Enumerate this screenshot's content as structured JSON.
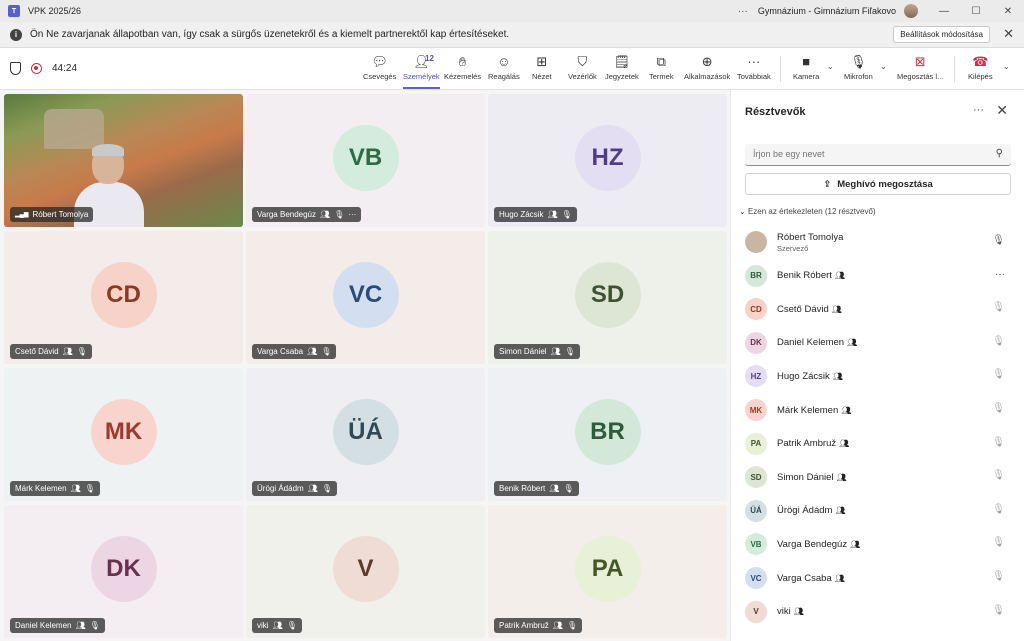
{
  "window": {
    "title": "VPK 2025/26",
    "org": "Gymnázium - Gimnázium Fiľakovo",
    "more": "···",
    "minimize": "—",
    "maximize": "☐",
    "close": "✕"
  },
  "banner": {
    "text": "Ön Ne zavarjanak állapotban van, így csak a sürgős üzenetekről és a kiemelt partnerektől kap értesítéseket.",
    "button": "Beállítások módosítása",
    "close": "✕"
  },
  "meeting": {
    "timer": "44:24"
  },
  "toolbar": {
    "chat": "Csevegés",
    "people": "Személyek",
    "people_count": "12",
    "hand": "Kézemelés",
    "react": "Reagálás",
    "view": "Nézet",
    "controls": "Vezérlők",
    "notes": "Jegyzetek",
    "rooms": "Termek",
    "apps": "Alkalmazások",
    "more": "Továbbiak",
    "camera": "Kamera",
    "mic": "Mikrofon",
    "share": "Megosztás l...",
    "leave": "Kilépés"
  },
  "tiles": [
    {
      "name": "Róbert Tomolya",
      "initials": "",
      "video": true
    },
    {
      "name": "Varga Bendegúz",
      "initials": "VB",
      "bg": "#d3ecdc",
      "fg": "#2e6b45"
    },
    {
      "name": "Hugo Zácsik",
      "initials": "HZ",
      "bg": "#e4def3",
      "fg": "#4f3e86"
    },
    {
      "name": "Csető Dávid",
      "initials": "CD",
      "bg": "#f7d2c8",
      "fg": "#8a3a23"
    },
    {
      "name": "Varga Csaba",
      "initials": "VC",
      "bg": "#d3dff0",
      "fg": "#2b4a7c"
    },
    {
      "name": "Simon Dániel",
      "initials": "SD",
      "bg": "#dde6d4",
      "fg": "#3f5230"
    },
    {
      "name": "Márk Kelemen",
      "initials": "MK",
      "bg": "#f9d4cf",
      "fg": "#9a3b2e"
    },
    {
      "name": "Ürögi Ádádm",
      "initials": "ÜÁ",
      "bg": "#d4dfe3",
      "fg": "#2f4a55"
    },
    {
      "name": "Benik Róbert",
      "initials": "BR",
      "bg": "#d4e8d9",
      "fg": "#2e5c3b"
    },
    {
      "name": "Daniel Kelemen",
      "initials": "DK",
      "bg": "#ecd6e3",
      "fg": "#6b2f52"
    },
    {
      "name": "viki",
      "initials": "V",
      "bg": "#efdcd4",
      "fg": "#5c3a2c"
    },
    {
      "name": "Patrik Ambruž",
      "initials": "PA",
      "bg": "#e8f0d8",
      "fg": "#44572a"
    }
  ],
  "panel": {
    "title": "Résztvevők",
    "search_placeholder": "Írjon be egy nevet",
    "share_label": "Meghívó megosztása",
    "section": "Ezen az értekezleten (12 résztvevő)",
    "participants": [
      {
        "name": "Róbert Tomolya",
        "role": "Szervező",
        "initials": "",
        "bg": "#c9b5a4",
        "fg": "#333"
      },
      {
        "name": "Benik Róbert",
        "initials": "BR",
        "bg": "#d4e8d9",
        "fg": "#2e5c3b"
      },
      {
        "name": "Csető Dávid",
        "initials": "CD",
        "bg": "#f7d2c8",
        "fg": "#8a3a23"
      },
      {
        "name": "Daniel Kelemen",
        "initials": "DK",
        "bg": "#ecd6e3",
        "fg": "#6b2f52"
      },
      {
        "name": "Hugo Zácsik",
        "initials": "HZ",
        "bg": "#e4def3",
        "fg": "#4f3e86"
      },
      {
        "name": "Márk Kelemen",
        "initials": "MK",
        "bg": "#f9d4cf",
        "fg": "#9a3b2e"
      },
      {
        "name": "Patrik Ambruž",
        "initials": "PA",
        "bg": "#e8f0d8",
        "fg": "#44572a"
      },
      {
        "name": "Simon Dániel",
        "initials": "SD",
        "bg": "#dde6d4",
        "fg": "#3f5230"
      },
      {
        "name": "Ürögi Ádádm",
        "initials": "ÜÁ",
        "bg": "#d4dfe3",
        "fg": "#2f4a55"
      },
      {
        "name": "Varga Bendegúz",
        "initials": "VB",
        "bg": "#d3ecdc",
        "fg": "#2e6b45"
      },
      {
        "name": "Varga Csaba",
        "initials": "VC",
        "bg": "#d3dff0",
        "fg": "#2b4a7c"
      },
      {
        "name": "viki",
        "initials": "V",
        "bg": "#efdcd4",
        "fg": "#5c3a2c"
      }
    ]
  }
}
